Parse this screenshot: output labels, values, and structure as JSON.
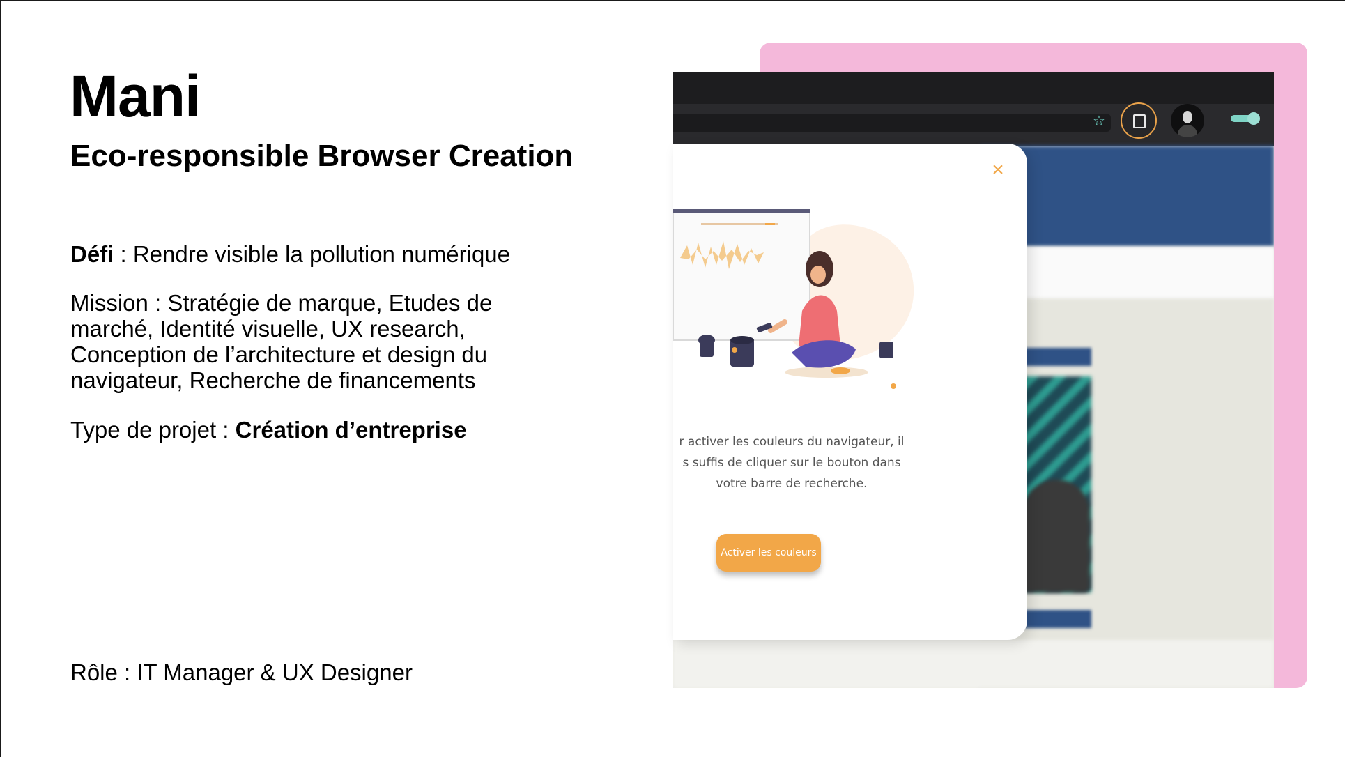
{
  "slide": {
    "title": "Mani",
    "subtitle": "Eco-responsible Browser Creation",
    "defi_label": "Défi",
    "defi_text": " : Rendre visible la pollution numérique",
    "mission_text": "Mission : Stratégie de marque, Etudes de marché, Identité visuelle, UX research, Conception de l’architecture et design du navigateur, Recherche de financements",
    "type_label": "Type de projet : ",
    "type_value": "Création d’entreprise",
    "role_text": "Rôle : IT Manager & UX Designer"
  },
  "modal": {
    "line1": "r activer les couleurs du navigateur, il",
    "line2": "s suffis de cliquer sur le bouton dans",
    "line3": "votre barre de recherche.",
    "button_label": "Activer les couleurs",
    "close_symbol": "×"
  },
  "colors": {
    "accent_orange": "#f2a748",
    "pink_card": "#f4b8da",
    "site_blue": "#2f5286",
    "toggle_teal": "#7fd4c6"
  },
  "icons": {
    "star": "star-icon",
    "eco": "eco-mode-icon",
    "close": "close-icon"
  }
}
